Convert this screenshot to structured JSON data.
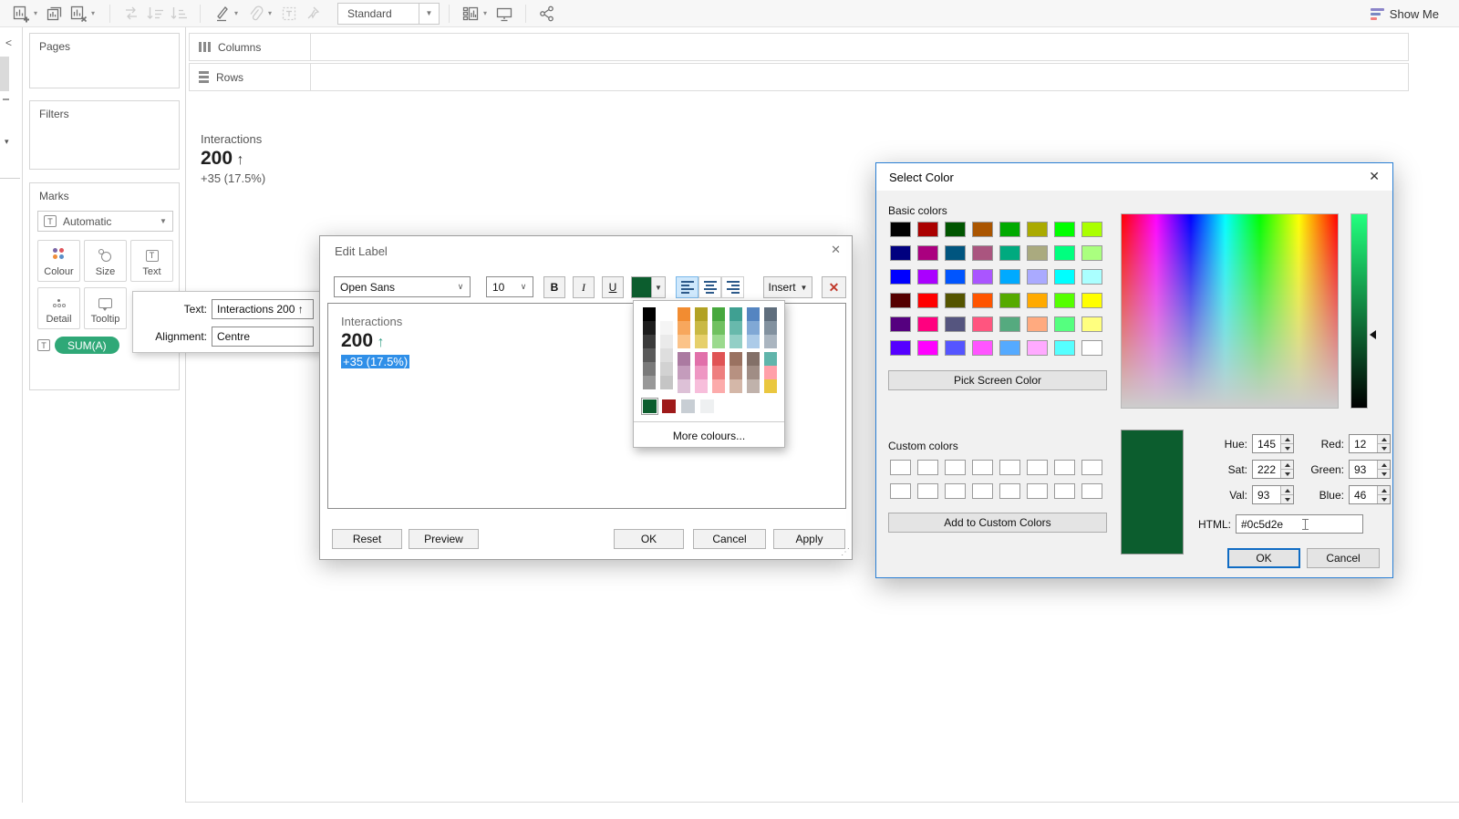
{
  "toolbar": {
    "fit_mode": "Standard",
    "show_me": "Show Me"
  },
  "left_panel": {
    "pages": "Pages",
    "filters": "Filters",
    "marks": {
      "title": "Marks",
      "mark_type": "Automatic",
      "colour": "Colour",
      "size": "Size",
      "text": "Text",
      "detail": "Detail",
      "tooltip": "Tooltip",
      "pill": "SUM(A)",
      "pill_color": "#2fa877"
    }
  },
  "shelves": {
    "columns": "Columns",
    "rows": "Rows"
  },
  "viz": {
    "title": "Interactions",
    "value": "200",
    "arrow": "↑",
    "delta": "+35 (17.5%)"
  },
  "label_flyout": {
    "text_label": "Text:",
    "text_value": "Interactions 200 ↑",
    "alignment_label": "Alignment:",
    "alignment_value": "Centre"
  },
  "edit_label": {
    "title": "Edit Label",
    "font": "Open Sans",
    "size": "10",
    "bold": "B",
    "italic": "I",
    "underline": "U",
    "insert": "Insert",
    "clear_glyph": "✕",
    "color": "#0c5d2e",
    "content": {
      "line1": "Interactions",
      "value": "200",
      "arrow": "↑",
      "selected": "+35 (17.5%)"
    },
    "palette": {
      "grays": [
        "#000000",
        "#1c1c1c",
        "#3b3b3b",
        "#5a5a5a",
        "#7a7a7a",
        "#989898"
      ],
      "whites": [
        "#ffffff",
        "#f5f5f5",
        "#eaeaea",
        "#dedede",
        "#d2d2d2",
        "#c5c5c5"
      ],
      "ramps_top": [
        [
          "#f28c31",
          "#f7a75d",
          "#fbc389"
        ],
        [
          "#b2a224",
          "#c9b944",
          "#e6d06b"
        ],
        [
          "#47a83e",
          "#70c160",
          "#9bda8e"
        ],
        [
          "#3fa092",
          "#68b9ac",
          "#93cfc6"
        ],
        [
          "#5585c1",
          "#80a8d5",
          "#accbe8"
        ],
        [
          "#5f6e7d",
          "#82919f",
          "#aab5c0"
        ]
      ],
      "ramps_bottom": [
        [
          "#ab7aa1",
          "#c49cbc",
          "#ddc1d7"
        ],
        [
          "#e170aa",
          "#ee97c3",
          "#f7bedb"
        ],
        [
          "#e05455",
          "#ee7f7f",
          "#fcabab"
        ],
        [
          "#9a7261",
          "#b79181",
          "#d4b7a8"
        ],
        [
          "#837068",
          "#a08d85",
          "#c0b2ab"
        ],
        [
          "#60b5ab",
          "#ffa0a9",
          "#eac73f"
        ]
      ],
      "recent": [
        "#0c5d2e",
        "#9e1a1a",
        "#c8ced4",
        "#eef0f1"
      ],
      "selected_index": 0,
      "more": "More colours..."
    },
    "buttons": {
      "reset": "Reset",
      "preview": "Preview",
      "ok": "OK",
      "cancel": "Cancel",
      "apply": "Apply"
    }
  },
  "select_color": {
    "title": "Select Color",
    "basic_label": "Basic colors",
    "basic_colors": [
      "#000000",
      "#aa0000",
      "#005500",
      "#aa5500",
      "#00aa00",
      "#aaaa00",
      "#00ff00",
      "#aaff00",
      "#00007f",
      "#aa007f",
      "#00557f",
      "#aa557f",
      "#00aa7f",
      "#aaaa7f",
      "#00ff7f",
      "#aaff7f",
      "#0000ff",
      "#aa00ff",
      "#0055ff",
      "#aa55ff",
      "#00aaff",
      "#aaaaff",
      "#00ffff",
      "#aaffff",
      "#550000",
      "#ff0000",
      "#555500",
      "#ff5500",
      "#55aa00",
      "#ffaa00",
      "#55ff00",
      "#ffff00",
      "#55007f",
      "#ff007f",
      "#55557f",
      "#ff557f",
      "#55aa7f",
      "#ffaa7f",
      "#55ff7f",
      "#ffff7f",
      "#5500ff",
      "#ff00ff",
      "#5555ff",
      "#ff55ff",
      "#55aaff",
      "#ffaaff",
      "#55ffff",
      "#ffffff"
    ],
    "pick_screen": "Pick Screen Color",
    "custom_label": "Custom colors",
    "custom_count": 16,
    "add_custom": "Add to Custom Colors",
    "hue_label": "Hue:",
    "hue": "145",
    "sat_label": "Sat:",
    "sat": "222",
    "val_label": "Val:",
    "val": "93",
    "red_label": "Red:",
    "red": "12",
    "green_label": "Green:",
    "green": "93",
    "blue_label": "Blue:",
    "blue": "46",
    "html_label": "HTML:",
    "html": "#0c5d2e",
    "preview_color": "#0c5d2e",
    "ok": "OK",
    "cancel": "Cancel"
  }
}
